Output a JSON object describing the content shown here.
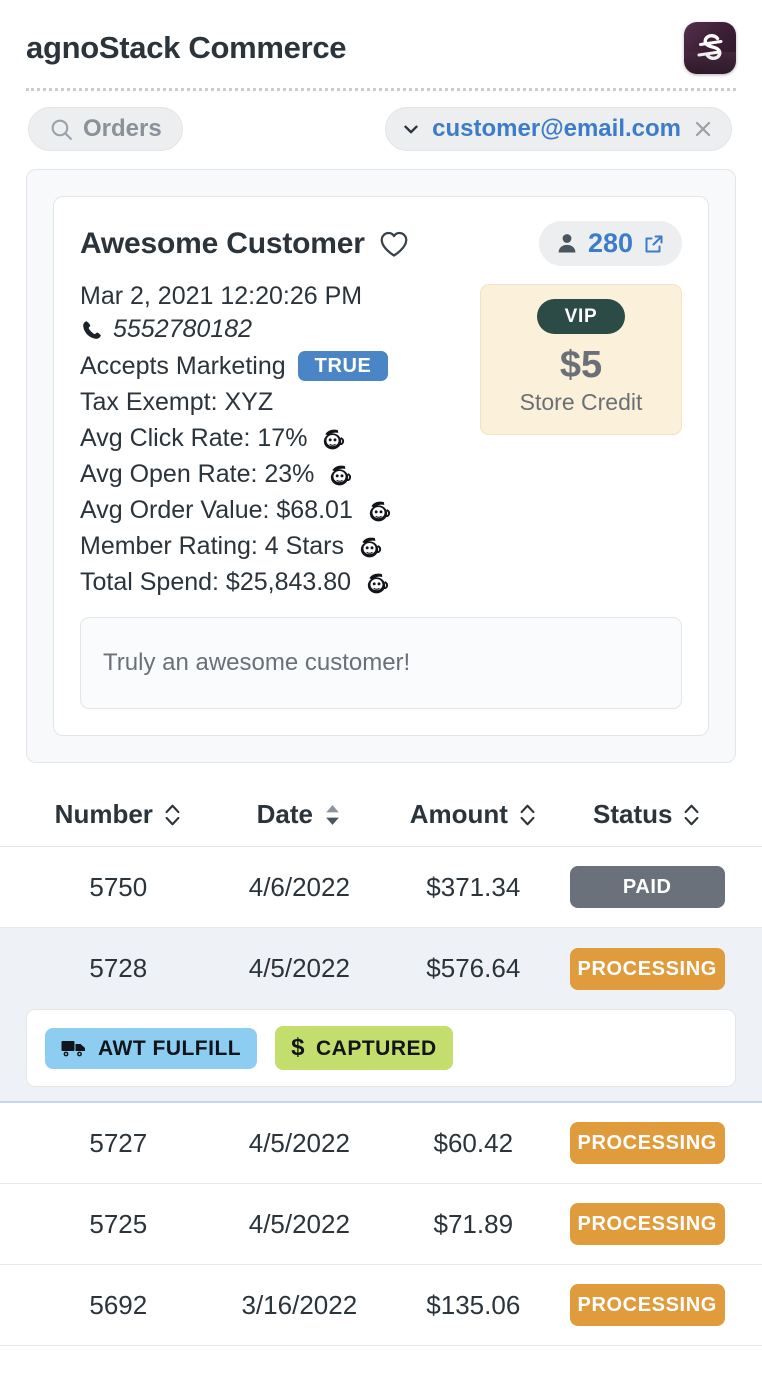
{
  "header": {
    "title": "agnoStack Commerce",
    "logo_icon": "agnostack-s-logo",
    "logo_color": "#3d1f36"
  },
  "filters": {
    "search": {
      "label": "Orders",
      "icon": "search-icon"
    },
    "email": {
      "label": "customer@email.com",
      "chevron_icon": "chevron-down-icon",
      "close_icon": "close-icon",
      "link_color": "#3d7cc9"
    }
  },
  "customer": {
    "name": "Awesome Customer",
    "favorite_icon": "heart-outline-icon",
    "count_badge": {
      "person_icon": "person-icon",
      "value": "280",
      "external_icon": "external-link-icon"
    },
    "date": "Mar 2, 2021 12:20:26 PM",
    "phone": "5552780182",
    "phone_icon": "phone-icon",
    "details": [
      {
        "label": "Accepts Marketing",
        "value": "TRUE",
        "type": "badge",
        "badge_color": "#4a86c5"
      },
      {
        "label": "Tax Exempt: XYZ",
        "type": "text"
      },
      {
        "label": "Avg Click Rate: 17%",
        "type": "text",
        "source_icon": "mailchimp-icon"
      },
      {
        "label": "Avg Open Rate: 23%",
        "type": "text",
        "source_icon": "mailchimp-icon"
      },
      {
        "label": "Avg Order Value: $68.01",
        "type": "text",
        "source_icon": "mailchimp-icon"
      },
      {
        "label": "Member Rating: 4 Stars",
        "type": "text",
        "source_icon": "mailchimp-icon"
      },
      {
        "label": "Total Spend: $25,843.80",
        "type": "text",
        "source_icon": "mailchimp-icon"
      }
    ],
    "credit": {
      "tier": "VIP",
      "tier_color": "#2c4a46",
      "amount": "$5",
      "label": "Store Credit",
      "background": "#fbf0d9"
    },
    "note": "Truly an awesome customer!"
  },
  "orders": {
    "columns": [
      {
        "label": "Number",
        "sort": "inactive",
        "sort_icon": "sort-chevrons-icon"
      },
      {
        "label": "Date",
        "sort": "active",
        "sort_icon": "sort-chevrons-filled-icon"
      },
      {
        "label": "Amount",
        "sort": "inactive",
        "sort_icon": "sort-chevrons-icon"
      },
      {
        "label": "Status",
        "sort": "inactive",
        "sort_icon": "sort-chevrons-icon"
      }
    ],
    "rows": [
      {
        "number": "5750",
        "date": "4/6/2022",
        "amount": "$371.34",
        "status": "PAID",
        "status_color": "#6b717a",
        "selected": false
      },
      {
        "number": "5728",
        "date": "4/5/2022",
        "amount": "$576.64",
        "status": "PROCESSING",
        "status_color": "#e09b3d",
        "selected": true,
        "tags": [
          {
            "label": "AWT FULFILL",
            "icon": "truck-icon",
            "color": "#8ecdf2"
          },
          {
            "label": "CAPTURED",
            "icon": "dollar-icon",
            "color": "#c3de6d"
          }
        ]
      },
      {
        "number": "5727",
        "date": "4/5/2022",
        "amount": "$60.42",
        "status": "PROCESSING",
        "status_color": "#e09b3d",
        "selected": false
      },
      {
        "number": "5725",
        "date": "4/5/2022",
        "amount": "$71.89",
        "status": "PROCESSING",
        "status_color": "#e09b3d",
        "selected": false
      },
      {
        "number": "5692",
        "date": "3/16/2022",
        "amount": "$135.06",
        "status": "PROCESSING",
        "status_color": "#e09b3d",
        "selected": false
      }
    ]
  }
}
